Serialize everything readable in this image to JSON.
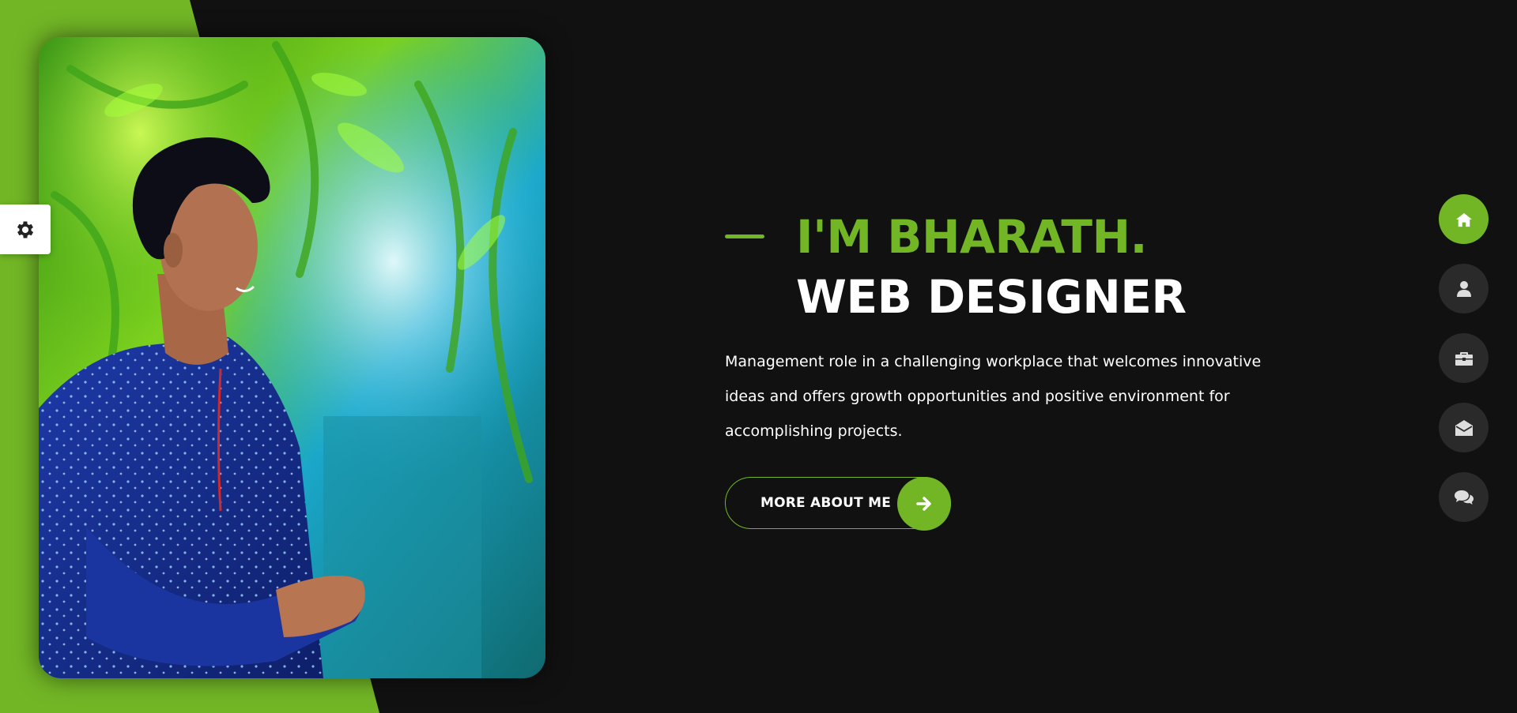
{
  "colors": {
    "accent": "#72b626",
    "background": "#111111",
    "nav_inactive": "#2b2a2a",
    "text": "#ffffff"
  },
  "settings": {
    "icon": "gear-icon"
  },
  "photo": {
    "description_icon": "portrait-photo"
  },
  "hero": {
    "name_line": "I'M BHARATH.",
    "role_line": "WEB DESIGNER",
    "intro": "Management role in a challenging workplace that welcomes innovative ideas and offers growth opportunities and positive environment for accomplishing projects.",
    "more_button_label": "MORE ABOUT ME",
    "more_button_icon": "arrow-right-icon"
  },
  "nav": {
    "items": [
      {
        "icon": "home-icon",
        "active": true
      },
      {
        "icon": "user-icon",
        "active": false
      },
      {
        "icon": "briefcase-icon",
        "active": false
      },
      {
        "icon": "envelope-open-icon",
        "active": false
      },
      {
        "icon": "comments-icon",
        "active": false
      }
    ]
  }
}
